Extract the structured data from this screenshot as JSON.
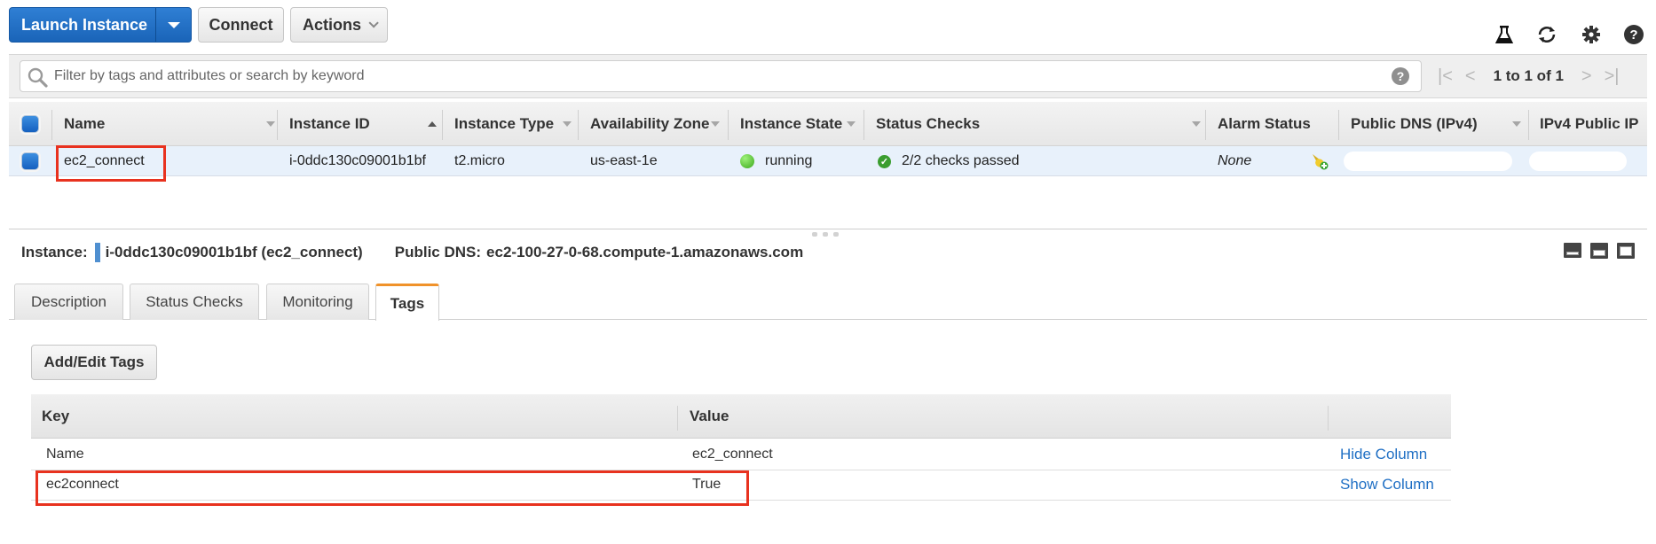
{
  "toolbar": {
    "launch_label": "Launch Instance",
    "connect_label": "Connect",
    "actions_label": "Actions",
    "right_icons": [
      "flask-icon",
      "refresh-icon",
      "gear-icon",
      "help-icon"
    ]
  },
  "filter": {
    "placeholder": "Filter by tags and attributes or search by keyword",
    "value": "",
    "pagination": "1 to 1 of 1"
  },
  "instances_table": {
    "columns": [
      {
        "label": "Name",
        "sort": "none"
      },
      {
        "label": "Instance ID",
        "sort": "ascending"
      },
      {
        "label": "Instance Type",
        "sort": "none"
      },
      {
        "label": "Availability Zone",
        "sort": "none"
      },
      {
        "label": "Instance State",
        "sort": "none"
      },
      {
        "label": "Status Checks",
        "sort": "none"
      },
      {
        "label": "Alarm Status",
        "sort": "none"
      },
      {
        "label": "Public DNS (IPv4)",
        "sort": "none"
      },
      {
        "label": "IPv4 Public IP",
        "sort": "none"
      }
    ],
    "rows": [
      {
        "selected": true,
        "name": "ec2_connect",
        "instance_id": "i-0ddc130c09001b1bf",
        "instance_type": "t2.micro",
        "availability_zone": "us-east-1e",
        "instance_state": "running",
        "status_checks": "2/2 checks passed",
        "alarm_status": "None",
        "public_dns": "",
        "public_ip": ""
      }
    ]
  },
  "detail": {
    "instance_label": "Instance:",
    "instance_value": "i-0ddc130c09001b1bf (ec2_connect)",
    "public_dns_label": "Public DNS:",
    "public_dns_value": "ec2-100-27-0-68.compute-1.amazonaws.com",
    "tabs": [
      {
        "label": "Description",
        "active": false
      },
      {
        "label": "Status Checks",
        "active": false
      },
      {
        "label": "Monitoring",
        "active": false
      },
      {
        "label": "Tags",
        "active": true
      }
    ],
    "add_edit_tags_label": "Add/Edit Tags",
    "tags_table": {
      "columns": [
        "Key",
        "Value",
        ""
      ],
      "rows": [
        {
          "key": "Name",
          "value": "ec2_connect",
          "action": "Hide Column"
        },
        {
          "key": "ec2connect",
          "value": "True",
          "action": "Show Column"
        }
      ]
    }
  },
  "colors": {
    "primary": "#1a64b8",
    "active_tab_accent": "#f0922a",
    "highlight_box": "#e8321f",
    "link": "#1f6fc4",
    "running": "#3ca81c"
  }
}
